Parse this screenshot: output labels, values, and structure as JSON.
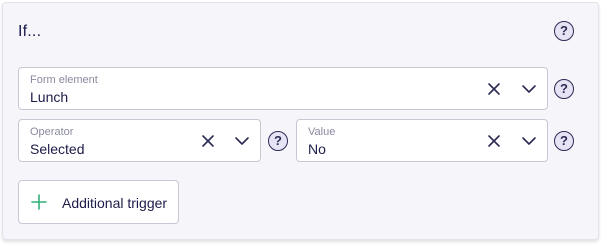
{
  "condition": {
    "title": "If...",
    "help_glyph": "?",
    "form_element": {
      "label": "Form element",
      "value": "Lunch"
    },
    "operator": {
      "label": "Operator",
      "value": "Selected"
    },
    "value_field": {
      "label": "Value",
      "value": "No"
    },
    "add_trigger_label": "Additional trigger"
  },
  "icons": {
    "help": "question-circle-icon",
    "clear": "close-icon",
    "dropdown": "chevron-down-icon",
    "add": "plus-icon"
  },
  "colors": {
    "panel_bg": "#f5f5fa",
    "text": "#1c1c4a",
    "label": "#8a8aa0",
    "help_fill": "#e6e3f4",
    "accent_plus": "#2fb07a"
  }
}
